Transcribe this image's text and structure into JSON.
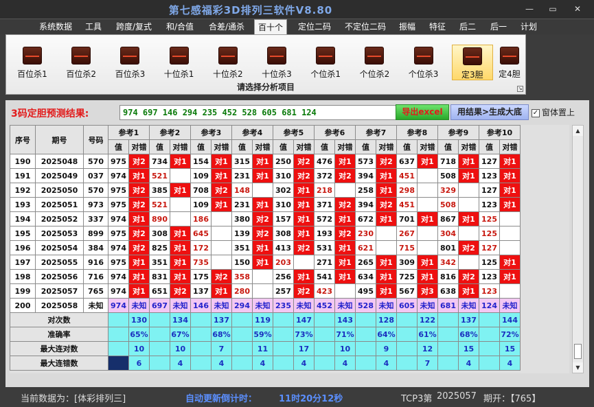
{
  "app": {
    "title": "第七感福彩3D排列三软件V8.80"
  },
  "window_controls": {
    "minimize": "—",
    "maximize": "▭",
    "close": "✕"
  },
  "menu": [
    {
      "label": "系统数据",
      "active": false
    },
    {
      "label": "工具",
      "active": false
    },
    {
      "label": "跨度/复式",
      "active": false
    },
    {
      "label": "和/合值",
      "active": false
    },
    {
      "label": "合差/通杀",
      "active": false
    },
    {
      "label": "百十个",
      "active": true
    },
    {
      "label": "定位二码",
      "active": false
    },
    {
      "label": "不定位二码",
      "active": false
    },
    {
      "label": "振幅",
      "active": false
    },
    {
      "label": "特征",
      "active": false
    },
    {
      "label": "后二",
      "active": false
    },
    {
      "label": "后一",
      "active": false
    },
    {
      "label": "计划",
      "active": false
    }
  ],
  "ribbon": {
    "caption": "请选择分析项目",
    "launcher_glyph": "↘",
    "icon_name": "chart-icon",
    "buttons": [
      {
        "label": "百位杀1",
        "active": false
      },
      {
        "label": "百位杀2",
        "active": false
      },
      {
        "label": "百位杀3",
        "active": false
      },
      {
        "label": "十位杀1",
        "active": false
      },
      {
        "label": "十位杀2",
        "active": false
      },
      {
        "label": "十位杀3",
        "active": false
      },
      {
        "label": "个位杀1",
        "active": false
      },
      {
        "label": "个位杀2",
        "active": false
      },
      {
        "label": "个位杀3",
        "active": false
      },
      {
        "label": "定3胆",
        "active": true
      },
      {
        "label": "定4胆",
        "active": false
      }
    ]
  },
  "prediction": {
    "label": "3码定胆预测结果:",
    "value": "974 697 146 294 235 452 528 605 681 124",
    "export_button": "导出excel",
    "generate_button": "用结果>生成大底",
    "topmost_label": "窗体置上",
    "topmost_checked": true
  },
  "table": {
    "header": {
      "seq": "序号",
      "period": "期号",
      "number": "号码",
      "value": "值",
      "check": "对错"
    },
    "refs": [
      "参考1",
      "参考2",
      "参考3",
      "参考4",
      "参考5",
      "参考6",
      "参考7",
      "参考8",
      "参考9",
      "参考10"
    ],
    "rows": [
      {
        "seq": "190",
        "period": "2025048",
        "number": "570",
        "cells": [
          [
            "975",
            "对2"
          ],
          [
            "734",
            "对1"
          ],
          [
            "154",
            "对1"
          ],
          [
            "315",
            "对1"
          ],
          [
            "250",
            "对2"
          ],
          [
            "476",
            "对1"
          ],
          [
            "573",
            "对2"
          ],
          [
            "637",
            "对1"
          ],
          [
            "718",
            "对1"
          ],
          [
            "127",
            "对1"
          ]
        ]
      },
      {
        "seq": "191",
        "period": "2025049",
        "number": "037",
        "cells": [
          [
            "974",
            "对1"
          ],
          [
            "521",
            ""
          ],
          [
            "109",
            "对1"
          ],
          [
            "231",
            "对1"
          ],
          [
            "310",
            "对2"
          ],
          [
            "372",
            "对2"
          ],
          [
            "394",
            "对1"
          ],
          [
            "451",
            ""
          ],
          [
            "508",
            "对1"
          ],
          [
            "123",
            "对1"
          ]
        ]
      },
      {
        "seq": "192",
        "period": "2025050",
        "number": "570",
        "cells": [
          [
            "975",
            "对2"
          ],
          [
            "385",
            "对1"
          ],
          [
            "708",
            "对2"
          ],
          [
            "148",
            ""
          ],
          [
            "302",
            "对1"
          ],
          [
            "218",
            ""
          ],
          [
            "258",
            "对1"
          ],
          [
            "298",
            ""
          ],
          [
            "329",
            ""
          ],
          [
            "127",
            "对1"
          ]
        ]
      },
      {
        "seq": "193",
        "period": "2025051",
        "number": "973",
        "cells": [
          [
            "975",
            "对2"
          ],
          [
            "521",
            ""
          ],
          [
            "109",
            "对1"
          ],
          [
            "231",
            "对1"
          ],
          [
            "310",
            "对1"
          ],
          [
            "371",
            "对2"
          ],
          [
            "394",
            "对2"
          ],
          [
            "451",
            ""
          ],
          [
            "508",
            ""
          ],
          [
            "123",
            "对1"
          ]
        ]
      },
      {
        "seq": "194",
        "period": "2025052",
        "number": "337",
        "cells": [
          [
            "974",
            "对1"
          ],
          [
            "890",
            ""
          ],
          [
            "186",
            ""
          ],
          [
            "380",
            "对2"
          ],
          [
            "157",
            "对1"
          ],
          [
            "572",
            "对1"
          ],
          [
            "672",
            "对1"
          ],
          [
            "701",
            "对1"
          ],
          [
            "867",
            "对1"
          ],
          [
            "125",
            ""
          ]
        ]
      },
      {
        "seq": "195",
        "period": "2025053",
        "number": "899",
        "cells": [
          [
            "975",
            "对2"
          ],
          [
            "308",
            "对1"
          ],
          [
            "645",
            ""
          ],
          [
            "139",
            "对2"
          ],
          [
            "308",
            "对1"
          ],
          [
            "193",
            "对2"
          ],
          [
            "230",
            ""
          ],
          [
            "267",
            ""
          ],
          [
            "304",
            ""
          ],
          [
            "125",
            ""
          ]
        ]
      },
      {
        "seq": "196",
        "period": "2025054",
        "number": "384",
        "cells": [
          [
            "974",
            "对2"
          ],
          [
            "825",
            "对1"
          ],
          [
            "172",
            ""
          ],
          [
            "351",
            "对1"
          ],
          [
            "413",
            "对2"
          ],
          [
            "531",
            "对1"
          ],
          [
            "621",
            ""
          ],
          [
            "715",
            ""
          ],
          [
            "801",
            "对2"
          ],
          [
            "127",
            ""
          ]
        ]
      },
      {
        "seq": "197",
        "period": "2025055",
        "number": "916",
        "cells": [
          [
            "975",
            "对1"
          ],
          [
            "351",
            "对1"
          ],
          [
            "735",
            ""
          ],
          [
            "150",
            "对1"
          ],
          [
            "203",
            ""
          ],
          [
            "271",
            "对1"
          ],
          [
            "265",
            "对1"
          ],
          [
            "309",
            "对1"
          ],
          [
            "342",
            ""
          ],
          [
            "125",
            "对1"
          ]
        ]
      },
      {
        "seq": "198",
        "period": "2025056",
        "number": "716",
        "cells": [
          [
            "974",
            "对1"
          ],
          [
            "831",
            "对1"
          ],
          [
            "175",
            "对2"
          ],
          [
            "358",
            ""
          ],
          [
            "256",
            "对1"
          ],
          [
            "541",
            "对1"
          ],
          [
            "634",
            "对1"
          ],
          [
            "725",
            "对1"
          ],
          [
            "816",
            "对2"
          ],
          [
            "123",
            "对1"
          ]
        ]
      },
      {
        "seq": "199",
        "period": "2025057",
        "number": "765",
        "cells": [
          [
            "974",
            "对1"
          ],
          [
            "651",
            "对2"
          ],
          [
            "137",
            "对1"
          ],
          [
            "280",
            ""
          ],
          [
            "257",
            "对2"
          ],
          [
            "423",
            ""
          ],
          [
            "495",
            "对1"
          ],
          [
            "567",
            "对3"
          ],
          [
            "638",
            "对1"
          ],
          [
            "123",
            ""
          ]
        ]
      },
      {
        "seq": "200",
        "period": "2025058",
        "number": "未知",
        "cells": [
          [
            "974",
            "未知"
          ],
          [
            "697",
            "未知"
          ],
          [
            "146",
            "未知"
          ],
          [
            "294",
            "未知"
          ],
          [
            "235",
            "未知"
          ],
          [
            "452",
            "未知"
          ],
          [
            "528",
            "未知"
          ],
          [
            "605",
            "未知"
          ],
          [
            "681",
            "未知"
          ],
          [
            "124",
            "未知"
          ]
        ]
      }
    ],
    "stats": [
      {
        "label": "对次数",
        "values": [
          "130",
          "134",
          "137",
          "119",
          "147",
          "143",
          "128",
          "122",
          "137",
          "144"
        ]
      },
      {
        "label": "准确率",
        "values": [
          "65%",
          "67%",
          "68%",
          "59%",
          "73%",
          "71%",
          "64%",
          "61%",
          "68%",
          "72%"
        ]
      },
      {
        "label": "最大连对数",
        "values": [
          "10",
          "10",
          "7",
          "11",
          "17",
          "10",
          "9",
          "12",
          "15",
          "15"
        ]
      },
      {
        "label": "最大连错数",
        "values": [
          "6",
          "4",
          "4",
          "4",
          "4",
          "4",
          "4",
          "7",
          "4",
          "4"
        ]
      }
    ]
  },
  "scrollbar": {
    "up": "▲",
    "down": "▼"
  },
  "status": {
    "source_label": "当前数据为：[体彩排列三]",
    "countdown_label": "自动更新倒计时：",
    "countdown_value": "11时20分12秒",
    "issue_label": "TCP3第",
    "issue_value": "2025057",
    "draw_label": "期开：【765】"
  },
  "colors": {
    "hit": "#ee1010",
    "miss_text": "#c8180f",
    "pending": "#f3c8f3",
    "stat": "#7ff2f2",
    "accent": "#5b8fff"
  }
}
